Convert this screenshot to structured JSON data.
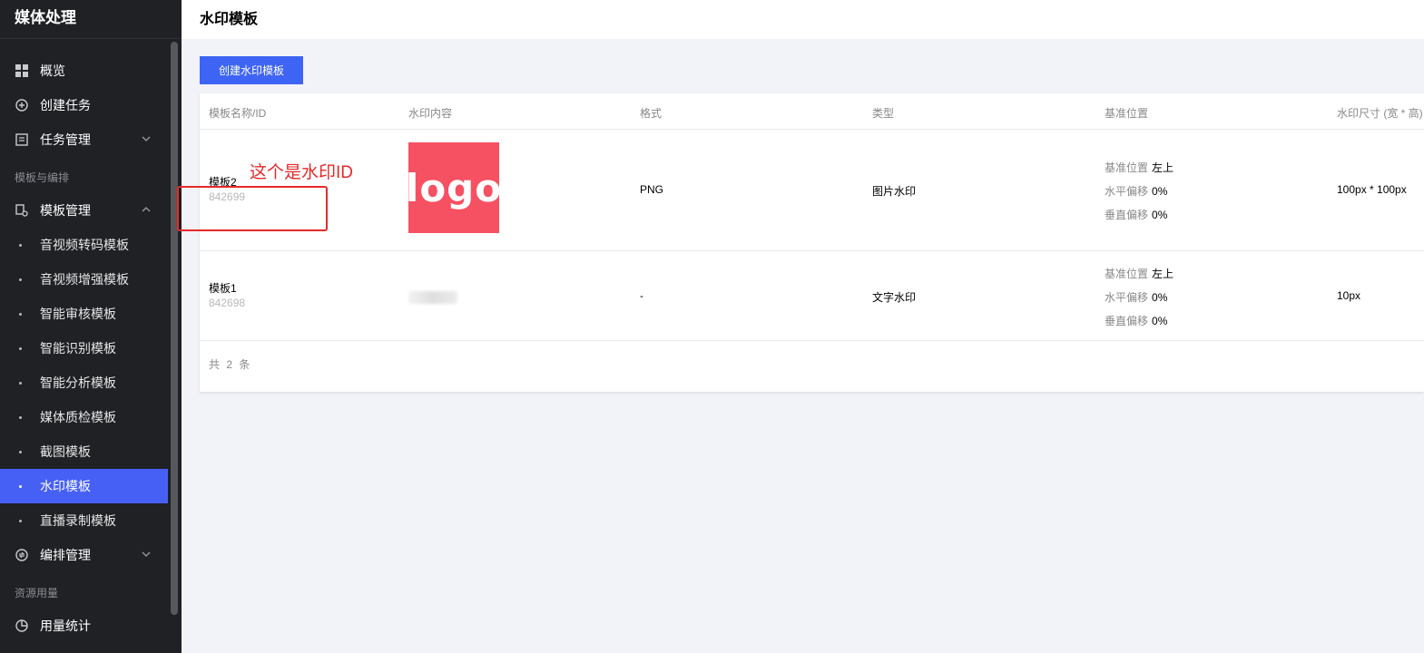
{
  "sidebar": {
    "title": "媒体处理",
    "items": [
      {
        "label": "概览",
        "icon": "grid-icon"
      },
      {
        "label": "创建任务",
        "icon": "plus-circle-icon"
      },
      {
        "label": "任务管理",
        "icon": "document-icon"
      }
    ],
    "section_templates": "模板与编排",
    "template_manage": "模板管理",
    "sub_items": [
      "音视频转码模板",
      "音视频增强模板",
      "智能审核模板",
      "智能识别模板",
      "智能分析模板",
      "媒体质检模板",
      "截图模板",
      "水印模板",
      "直播录制模板"
    ],
    "active_item": "水印模板",
    "orchestration": "编排管理",
    "section_resources": "资源用量",
    "usage": "用量统计"
  },
  "header": {
    "title": "水印模板"
  },
  "toolbar": {
    "create_label": "创建水印模板"
  },
  "table": {
    "columns": [
      "模板名称/ID",
      "水印内容",
      "格式",
      "类型",
      "基准位置",
      "水印尺寸 (宽 * 高)"
    ],
    "position_labels": {
      "base": "基准位置",
      "horizontal": "水平偏移",
      "vertical": "垂直偏移"
    },
    "rows": [
      {
        "name": "模板2",
        "id": "842699",
        "content_image_text": "logo",
        "format": "PNG",
        "type": "图片水印",
        "base_position": "左上",
        "h_offset": "0%",
        "v_offset": "0%",
        "size": "100px * 100px"
      },
      {
        "name": "模板1",
        "id": "842698",
        "format": "-",
        "type": "文字水印",
        "base_position": "左上",
        "h_offset": "0%",
        "v_offset": "0%",
        "size": "10px"
      }
    ],
    "total": "共 2 条"
  },
  "annotation": {
    "text": "这个是水印ID"
  },
  "colors": {
    "accent": "#3e64f5",
    "sidebar_bg": "#1f2125",
    "annotation": "#e62929",
    "logo_bg": "#f55162"
  }
}
